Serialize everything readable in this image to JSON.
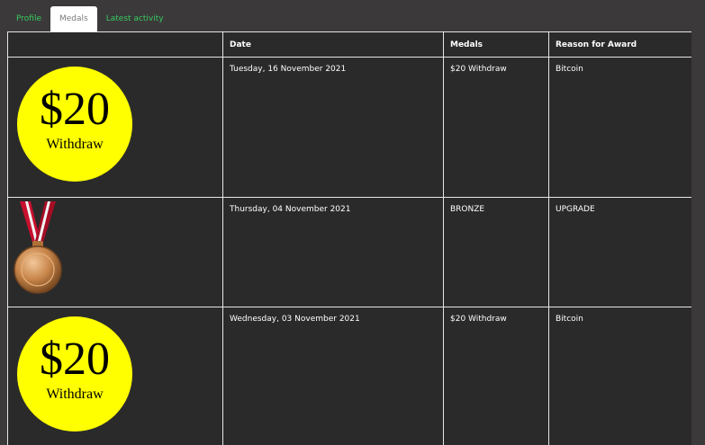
{
  "tabs": [
    {
      "label": "Profile",
      "active": false
    },
    {
      "label": "Medals",
      "active": true
    },
    {
      "label": "Latest activity",
      "active": false
    }
  ],
  "table": {
    "headers": [
      "",
      "Date",
      "Medals",
      "Reason for Award"
    ],
    "rows": [
      {
        "image": "withdraw-20-badge",
        "badge_amount": "$20",
        "badge_word": "Withdraw",
        "date": "Tuesday, 16 November 2021",
        "medal": "$20 Withdraw",
        "reason": "Bitcoin"
      },
      {
        "image": "bronze-medal-icon",
        "date": "Thursday, 04 November 2021",
        "medal": "BRONZE",
        "reason": "UPGRADE"
      },
      {
        "image": "withdraw-20-badge",
        "badge_amount": "$20",
        "badge_word": "Withdraw",
        "date": "Wednesday, 03 November 2021",
        "medal": "$20 Withdraw",
        "reason": "Bitcoin"
      }
    ]
  },
  "colors": {
    "page_bg": "#3b393a",
    "table_bg": "#2b2a2a",
    "tab_link": "#37c95e",
    "badge_yellow": "#ffff00",
    "ribbon_red": "#c8102e",
    "medal_bronze": "#c8864a"
  }
}
